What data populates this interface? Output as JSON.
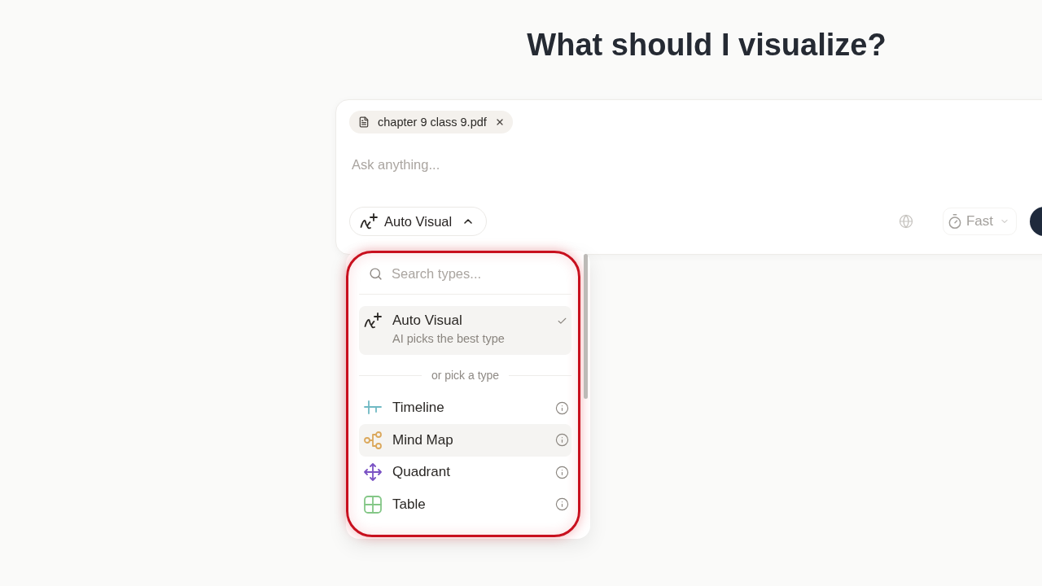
{
  "heading": "What should I visualize?",
  "composer": {
    "attachments": [
      {
        "name": "chapter 9 class 9.pdf"
      }
    ],
    "input": {
      "placeholder": "Ask anything..."
    },
    "visual_type_button": {
      "label": "Auto Visual",
      "expanded": true
    },
    "speed_button": {
      "label": "Fast"
    }
  },
  "type_menu": {
    "search": {
      "placeholder": "Search types..."
    },
    "auto_option": {
      "title": "Auto Visual",
      "subtitle": "AI picks the best type",
      "selected": true
    },
    "separator": "or pick a type",
    "types": [
      {
        "kind": "timeline",
        "label": "Timeline",
        "color": "#6fb9c3",
        "selected": false,
        "hovered": false
      },
      {
        "kind": "mindmap",
        "label": "Mind Map",
        "color": "#dba85c",
        "selected": false,
        "hovered": true
      },
      {
        "kind": "quadrant",
        "label": "Quadrant",
        "color": "#7a52c4",
        "selected": false,
        "hovered": false
      },
      {
        "kind": "table",
        "label": "Table",
        "color": "#84c787",
        "selected": false,
        "hovered": false
      }
    ]
  }
}
